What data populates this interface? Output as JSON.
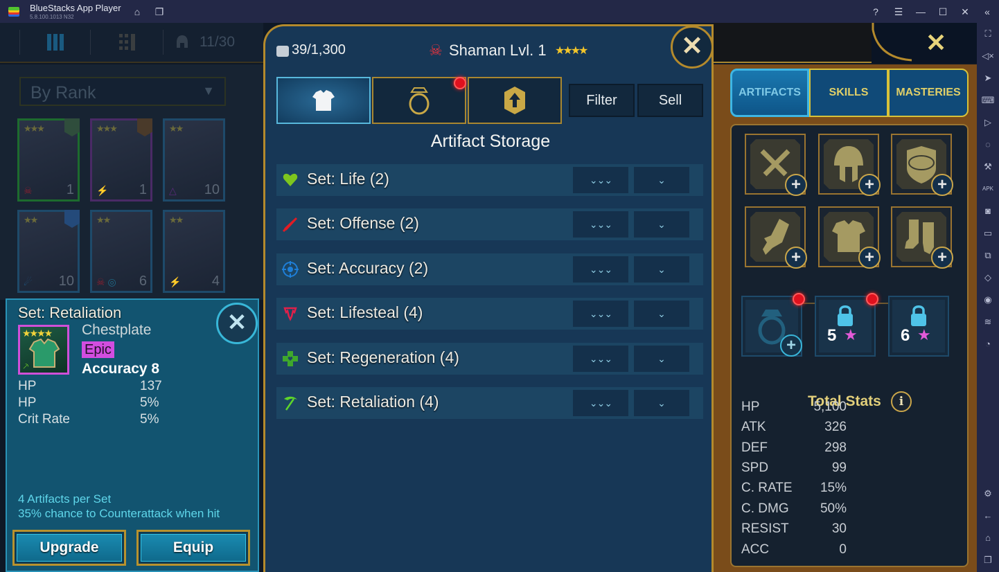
{
  "window": {
    "app_title": "BlueStacks App Player",
    "version": "5.8.100.1013  N32",
    "controls": [
      "help-icon",
      "menu-icon",
      "minimize-icon",
      "maximize-icon",
      "close-icon",
      "collapse-sidebar-icon"
    ]
  },
  "emulator_sidebar": {
    "icons": [
      "fullscreen-icon",
      "volume-mute-icon",
      "pointer-icon",
      "keyboard-icon",
      "macro-record-icon",
      "rotate-icon",
      "build-icon",
      "apk-install-icon",
      "screenshot-icon",
      "folder-icon",
      "multi-instance-icon",
      "shake-icon",
      "location-icon",
      "layers-icon",
      "performance-icon",
      "settings-icon",
      "back-icon",
      "home-icon",
      "recent-apps-icon"
    ]
  },
  "hero_list": {
    "count": "11/30",
    "sort_label": "By Rank",
    "heroes": [
      {
        "stars": "★★★",
        "level": "1",
        "frame": "green",
        "affinity": "skull",
        "badge": "shield"
      },
      {
        "stars": "★★★",
        "level": "1",
        "frame": "purple",
        "affinity": "force",
        "badge": "sword"
      },
      {
        "stars": "★★",
        "level": "10",
        "frame": "blue",
        "affinity": "void",
        "badge": ""
      },
      {
        "stars": "★★",
        "level": "10",
        "frame": "blue",
        "affinity": "magic",
        "badge": "heart"
      },
      {
        "stars": "★★",
        "level": "6",
        "frame": "blue",
        "affinity": "skull-magic",
        "badge": ""
      },
      {
        "stars": "★★",
        "level": "4",
        "frame": "blue",
        "affinity": "force",
        "badge": ""
      }
    ]
  },
  "artifact_detail": {
    "set_title": "Set: Retaliation",
    "item_type": "Chestplate",
    "rarity": "Epic",
    "rarity_color": "#d24de0",
    "stars": "★★★★",
    "primary_stat": "Accuracy 8",
    "substats": [
      {
        "label": "HP",
        "value": "137"
      },
      {
        "label": "HP",
        "value": "5%"
      },
      {
        "label": "Crit Rate",
        "value": "5%"
      }
    ],
    "set_info_1": "4 Artifacts per Set",
    "set_info_2": "35% chance to Counterattack when hit",
    "upgrade_label": "Upgrade",
    "equip_label": "Equip"
  },
  "storage": {
    "count": "39/1,300",
    "hero_name": "Shaman Lvl. 1",
    "hero_stars": "★★★★",
    "tabs": [
      {
        "name": "artifacts-tab",
        "icon": "chestplate-icon",
        "active": true
      },
      {
        "name": "accessories-tab",
        "icon": "ring-icon",
        "active": false,
        "notification": true
      },
      {
        "name": "upgrade-tab",
        "icon": "upgrade-arrow-icon",
        "active": false
      }
    ],
    "filter_label": "Filter",
    "sell_label": "Sell",
    "heading": "Artifact Storage",
    "sets": [
      {
        "label": "Set: Life (2)",
        "icon": "heart-icon",
        "color": "#7ec61e"
      },
      {
        "label": "Set: Offense (2)",
        "icon": "sword-icon",
        "color": "#e01c24"
      },
      {
        "label": "Set: Accuracy (2)",
        "icon": "target-icon",
        "color": "#1e7fd8"
      },
      {
        "label": "Set: Lifesteal (4)",
        "icon": "fangs-icon",
        "color": "#e0204a"
      },
      {
        "label": "Set: Regeneration (4)",
        "icon": "cross-heart-icon",
        "color": "#3fa82c"
      },
      {
        "label": "Set: Retaliation (4)",
        "icon": "scythe-icon",
        "color": "#5ed62a"
      }
    ],
    "sort_glyph": "⌄⌄⌄",
    "expand_glyph": "⌄"
  },
  "hero_panel": {
    "tabs": [
      {
        "label": "ARTIFACTS",
        "active": true
      },
      {
        "label": "SKILLS",
        "active": false
      },
      {
        "label": "MASTERIES",
        "active": false
      }
    ],
    "gear_slots": [
      "weapon-slot",
      "helmet-slot",
      "shield-slot",
      "gauntlets-slot",
      "chestplate-slot",
      "boots-slot"
    ],
    "accessory_slots": [
      {
        "name": "ring-slot",
        "locked": false,
        "notification": true
      },
      {
        "name": "amulet-slot",
        "locked": true,
        "required_stars": "5",
        "notification": true
      },
      {
        "name": "banner-slot",
        "locked": true,
        "required_stars": "6",
        "notification": false
      }
    ],
    "total_stats_title": "Total Stats",
    "info_label": "i",
    "stats": [
      {
        "label": "HP",
        "value": "5,100"
      },
      {
        "label": "ATK",
        "value": "326"
      },
      {
        "label": "DEF",
        "value": "298"
      },
      {
        "label": "SPD",
        "value": "99"
      },
      {
        "label": "C. RATE",
        "value": "15%"
      },
      {
        "label": "C. DMG",
        "value": "50%"
      },
      {
        "label": "RESIST",
        "value": "30"
      },
      {
        "label": "ACC",
        "value": "0"
      }
    ]
  }
}
